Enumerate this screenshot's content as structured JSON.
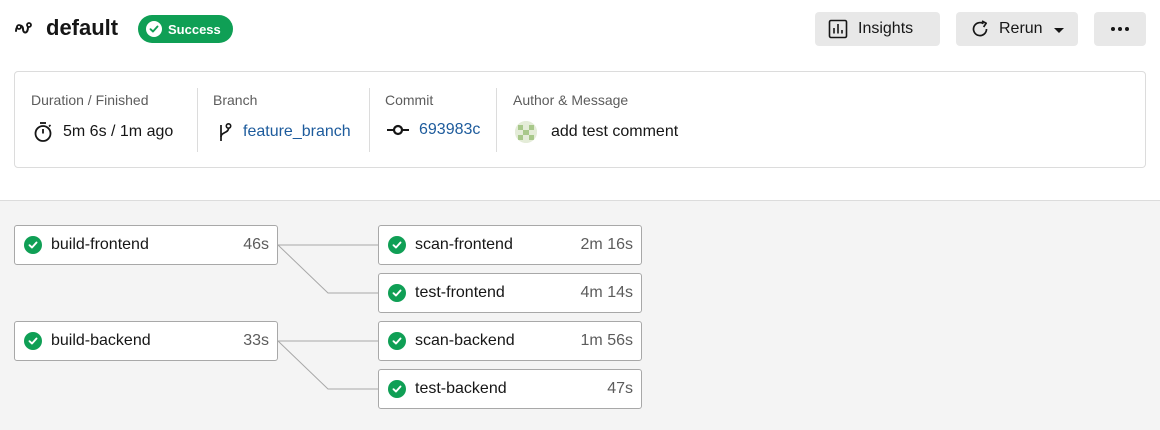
{
  "header": {
    "title": "default",
    "status": "Success",
    "insights_label": "Insights",
    "rerun_label": "Rerun",
    "more_label": "•••"
  },
  "summary": {
    "duration": {
      "label": "Duration / Finished",
      "value": "5m 6s / 1m ago"
    },
    "branch": {
      "label": "Branch",
      "value": "feature_branch"
    },
    "commit": {
      "label": "Commit",
      "value": "693983c"
    },
    "author": {
      "label": "Author & Message",
      "message": "add test comment"
    }
  },
  "jobs": [
    {
      "name": "build-frontend",
      "duration": "46s",
      "status": "success"
    },
    {
      "name": "scan-frontend",
      "duration": "2m 16s",
      "status": "success"
    },
    {
      "name": "test-frontend",
      "duration": "4m 14s",
      "status": "success"
    },
    {
      "name": "build-backend",
      "duration": "33s",
      "status": "success"
    },
    {
      "name": "scan-backend",
      "duration": "1m 56s",
      "status": "success"
    },
    {
      "name": "test-backend",
      "duration": "47s",
      "status": "success"
    }
  ],
  "colors": {
    "success": "#0f9f55",
    "link": "#1d5b9c",
    "button_bg": "#e8e8e8",
    "canvas_bg": "#f4f4f4"
  },
  "icons": [
    "workflow-icon",
    "check-icon",
    "insights-icon",
    "rerun-icon",
    "more-icon",
    "stopwatch-icon",
    "branch-icon",
    "commit-icon",
    "avatar"
  ]
}
